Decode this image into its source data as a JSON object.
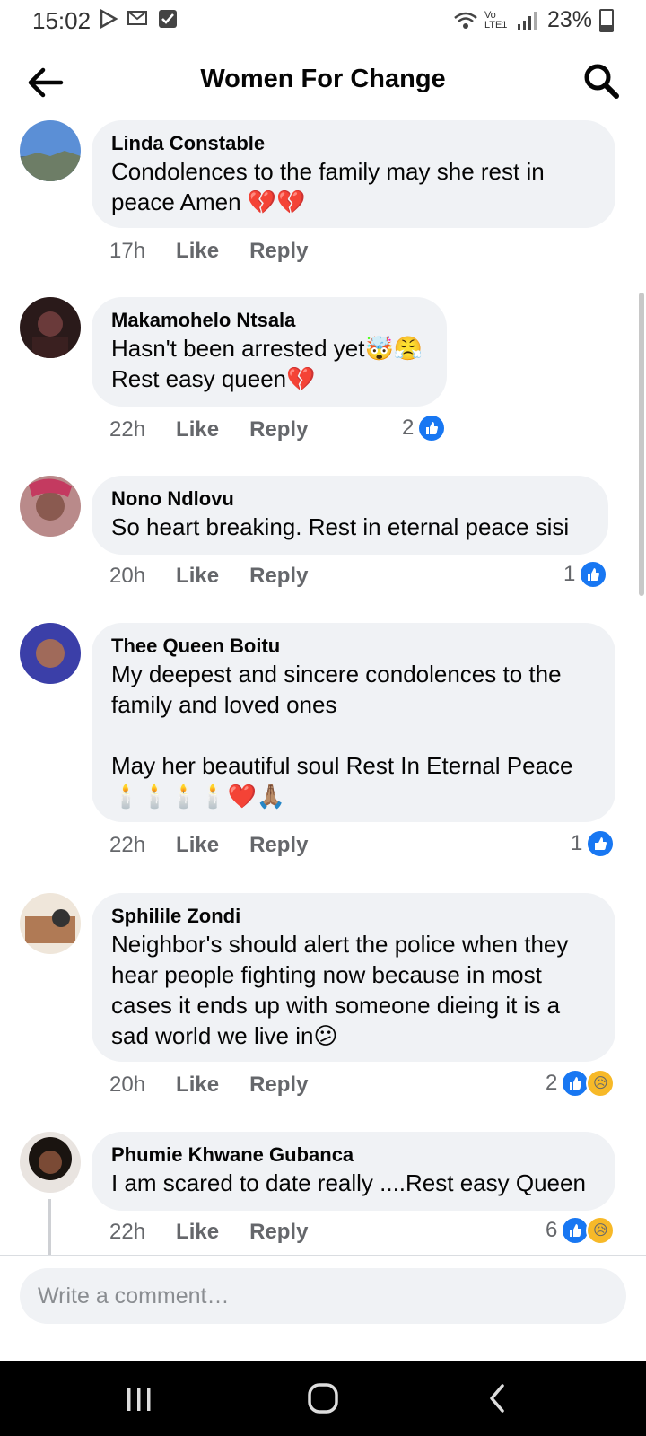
{
  "status_bar": {
    "time": "15:02",
    "network": "Vo LTE1",
    "battery": "23%"
  },
  "header": {
    "title": "Women For Change"
  },
  "comments": [
    {
      "name": "Linda Constable",
      "text": "Condolences to the family may she rest in peace Amen 💔💔",
      "time": "17h",
      "like": "Like",
      "reply": "Reply",
      "reaction_count": ""
    },
    {
      "name": "Makamohelo Ntsala",
      "text": "Hasn't been arrested yet🤯😤\nRest easy queen💔",
      "time": "22h",
      "like": "Like",
      "reply": "Reply",
      "reaction_count": "2"
    },
    {
      "name": "Nono Ndlovu",
      "text": "So heart breaking. Rest in eternal peace sisi",
      "time": "20h",
      "like": "Like",
      "reply": "Reply",
      "reaction_count": "1"
    },
    {
      "name": "Thee Queen Boitu",
      "text": "My deepest and sincere condolences to the family and loved ones\n\nMay her beautiful soul Rest In Eternal Peace\n🕯️🕯️🕯️🕯️❤️🙏🏽",
      "time": "22h",
      "like": "Like",
      "reply": "Reply",
      "reaction_count": "1"
    },
    {
      "name": "Sphilile Zondi",
      "text": "Neighbor's should alert the police when they hear people fighting now because in most cases it ends up with someone dieing it is a sad world we live in😕",
      "time": "20h",
      "like": "Like",
      "reply": "Reply",
      "reaction_count": "2"
    },
    {
      "name": "Phumie Khwane Gubanca",
      "text": "I am scared to date really ....Rest easy Queen",
      "time": "22h",
      "like": "Like",
      "reply": "Reply",
      "reaction_count": "6"
    }
  ],
  "composer": {
    "placeholder": "Write a comment…"
  },
  "icons": {
    "back": "back-arrow-icon",
    "search": "search-icon",
    "like_reaction": "thumbs-up-icon",
    "sad_reaction": "sad-face-icon"
  },
  "colors": {
    "accent": "#1877f2",
    "bubble": "#f0f2f5",
    "meta": "#65676b"
  }
}
